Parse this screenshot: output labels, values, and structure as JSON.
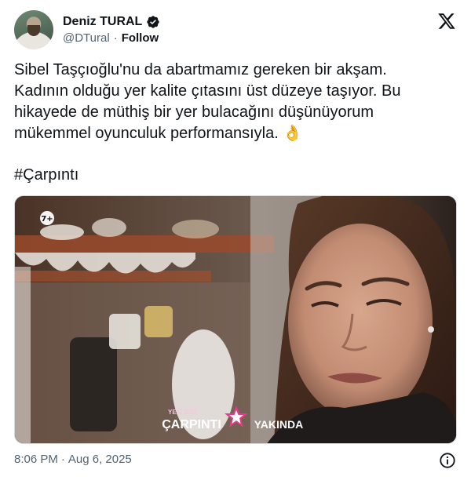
{
  "author": {
    "display_name": "Deniz TURAL",
    "handle": "@DTural",
    "separator": "·",
    "follow_label": "Follow"
  },
  "tweet": {
    "lines": [
      "Sibel Taşçıoğlu'nu da abartmamız gereken bir akşam.",
      "Kadının olduğu yer kalite çıtasını üst düzeye taşıyor. Bu",
      "hikayede de müthiş bir yer bulacağını düşünüyorum",
      "mükemmel oyunculuk performansıyla. 👌"
    ],
    "hashtag": "#Çarpıntı"
  },
  "media": {
    "channel_badge": "7+",
    "overlay_small": "YENİ DİZİ",
    "overlay_title": "ÇARPINTI",
    "overlay_right": "YAKINDA"
  },
  "footer": {
    "time": "8:06 PM",
    "separator": "·",
    "date": "Aug 6, 2025"
  },
  "icons": {
    "verified": "verified-badge-icon",
    "brand": "x-logo-icon",
    "info": "info-icon"
  },
  "colors": {
    "verified_blue": "#1d9bf0",
    "muted_text": "#536471",
    "primary_text": "#0f1419"
  }
}
